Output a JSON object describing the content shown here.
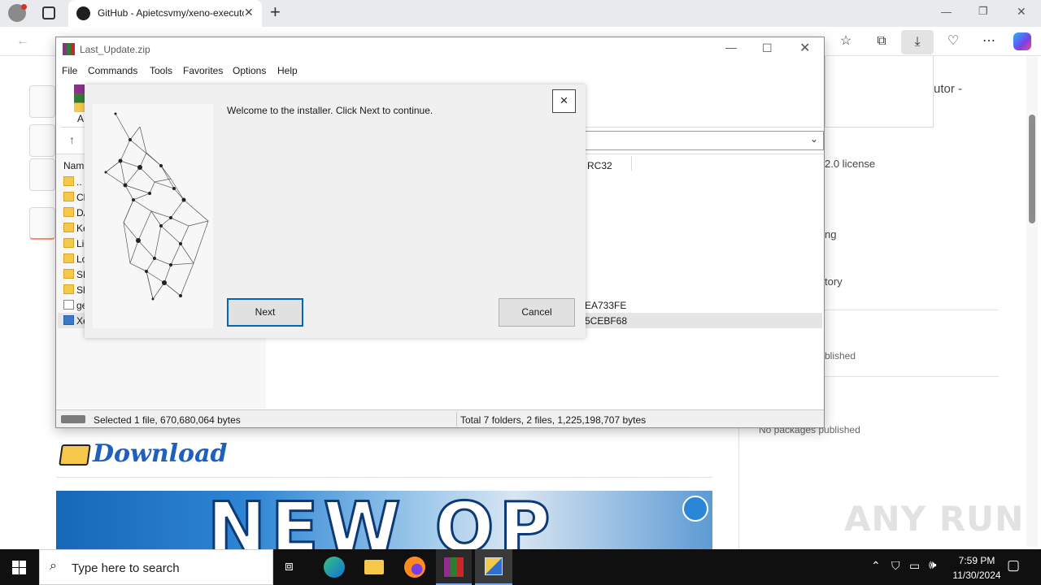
{
  "browser": {
    "tab_title": "GitHub - Apietcsvmy/xeno-executor",
    "new_tab_symbol": "+",
    "controls": {
      "minimize": "—",
      "restore": "❐",
      "close": "✕"
    }
  },
  "github_page": {
    "about_fragment": "utor -",
    "license_fragment": "2.0 license",
    "ng_fragment": "ng",
    "tory_fragment": "tory",
    "published_fragment": "blished",
    "packages_text": "No packages published",
    "download_heading": "Download",
    "banner_text": "NEW OP"
  },
  "winrar": {
    "title": "Last_Update.zip",
    "menu": [
      "File",
      "Commands",
      "Tools",
      "Favorites",
      "Options",
      "Help"
    ],
    "toolbar_first_label": "A",
    "column_name_header": "Nam",
    "column_crc_header": "RC32",
    "file_rows": [
      {
        "name": "..",
        "icon": "folder-icon",
        "crc": ""
      },
      {
        "name": "Cl",
        "icon": "folder-icon",
        "crc": ""
      },
      {
        "name": "DA",
        "icon": "folder-icon",
        "crc": ""
      },
      {
        "name": "Ke",
        "icon": "folder-icon",
        "crc": ""
      },
      {
        "name": "Lic",
        "icon": "folder-icon",
        "crc": ""
      },
      {
        "name": "Lo",
        "icon": "folder-icon",
        "crc": ""
      },
      {
        "name": "SD",
        "icon": "folder-icon",
        "crc": ""
      },
      {
        "name": "Sh",
        "icon": "folder-icon",
        "crc": ""
      },
      {
        "name": "ge",
        "icon": "file-icon",
        "crc": "EA733FE"
      },
      {
        "name": "Xe",
        "icon": "exe-icon",
        "crc": "5CEBF68"
      }
    ],
    "status_left": "Selected 1 file, 670,680,064 bytes",
    "status_right": "Total 7 folders, 2 files, 1,225,198,707 bytes"
  },
  "installer": {
    "welcome_text": "Welcome to the installer. Click Next to continue.",
    "close_symbol": "×",
    "next_label": "Next",
    "cancel_label": "Cancel"
  },
  "taskbar": {
    "search_placeholder": "Type here to search",
    "time": "7:59 PM",
    "date": "11/30/2024"
  },
  "watermark": "ANY RUN",
  "colors": {
    "accent_blue": "#0067c0",
    "download_blue": "#1e5fbf",
    "banner_blue": "#1d5fa8",
    "taskbar_bg": "#101010",
    "folder_yellow": "#f5c84c"
  }
}
